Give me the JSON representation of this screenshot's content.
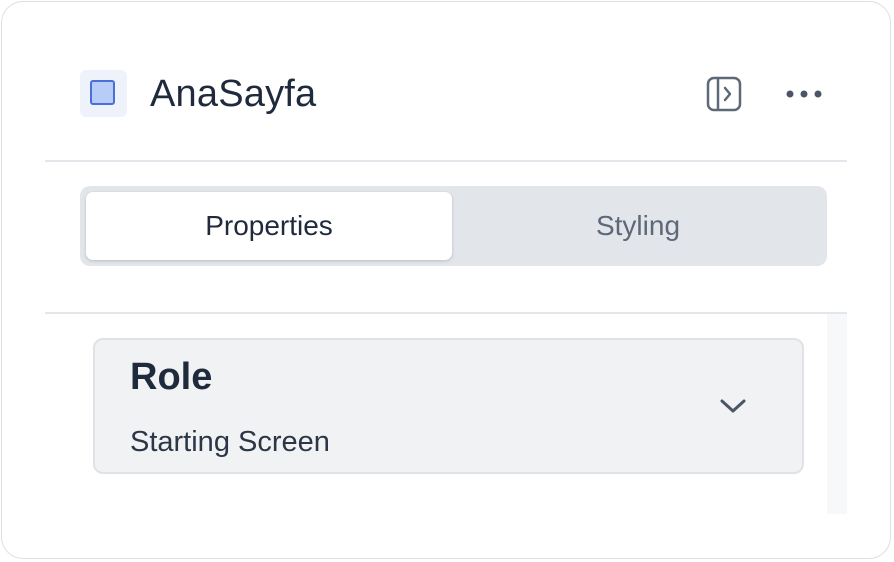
{
  "header": {
    "title": "AnaSayfa",
    "page_icon": "page-square-icon",
    "actions": [
      {
        "name": "toggle-panel",
        "icon": "sidebar-panel-icon"
      },
      {
        "name": "more-options",
        "icon": "more-horizontal-icon"
      }
    ]
  },
  "tabs": [
    {
      "label": "Properties",
      "active": true
    },
    {
      "label": "Styling",
      "active": false
    }
  ],
  "role_select": {
    "label": "Role",
    "value": "Starting Screen",
    "icon": "chevron-down-icon"
  },
  "colors": {
    "accent": "#4a6fd6",
    "icon_fill": "#b8ccf8",
    "text": "#1f2a3c",
    "muted_text": "#5d6878"
  }
}
